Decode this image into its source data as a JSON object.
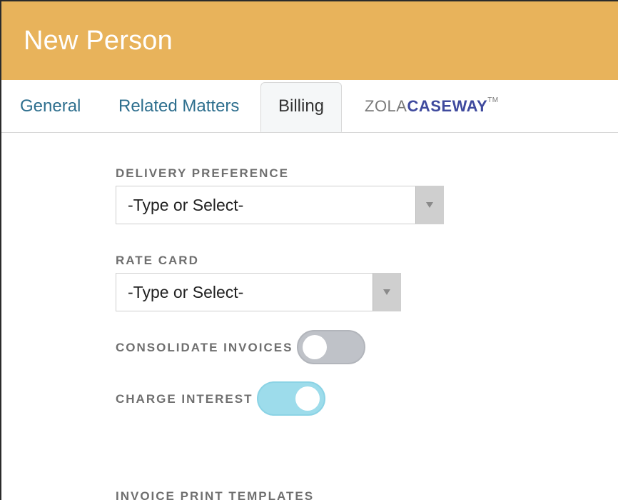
{
  "header": {
    "title": "New Person"
  },
  "tabs": {
    "general": "General",
    "related": "Related Matters",
    "billing": "Billing",
    "zola_prefix": "ZOLA",
    "zola_suffix": "CASEWAY",
    "zola_tm": "TM"
  },
  "billing": {
    "delivery": {
      "label": "DELIVERY PREFERENCE",
      "value": "-Type or Select-"
    },
    "rate_card": {
      "label": "RATE CARD",
      "value": "-Type or Select-"
    },
    "consolidate": {
      "label": "CONSOLIDATE INVOICES",
      "enabled": false
    },
    "interest": {
      "label": "CHARGE INTEREST",
      "enabled": true
    },
    "templates": {
      "label": "INVOICE PRINT TEMPLATES"
    }
  },
  "colors": {
    "header": "#e8b35b",
    "tab_link": "#2e6f8e",
    "toggle_on": "#9ddceb",
    "toggle_off": "#bfc2c8"
  }
}
